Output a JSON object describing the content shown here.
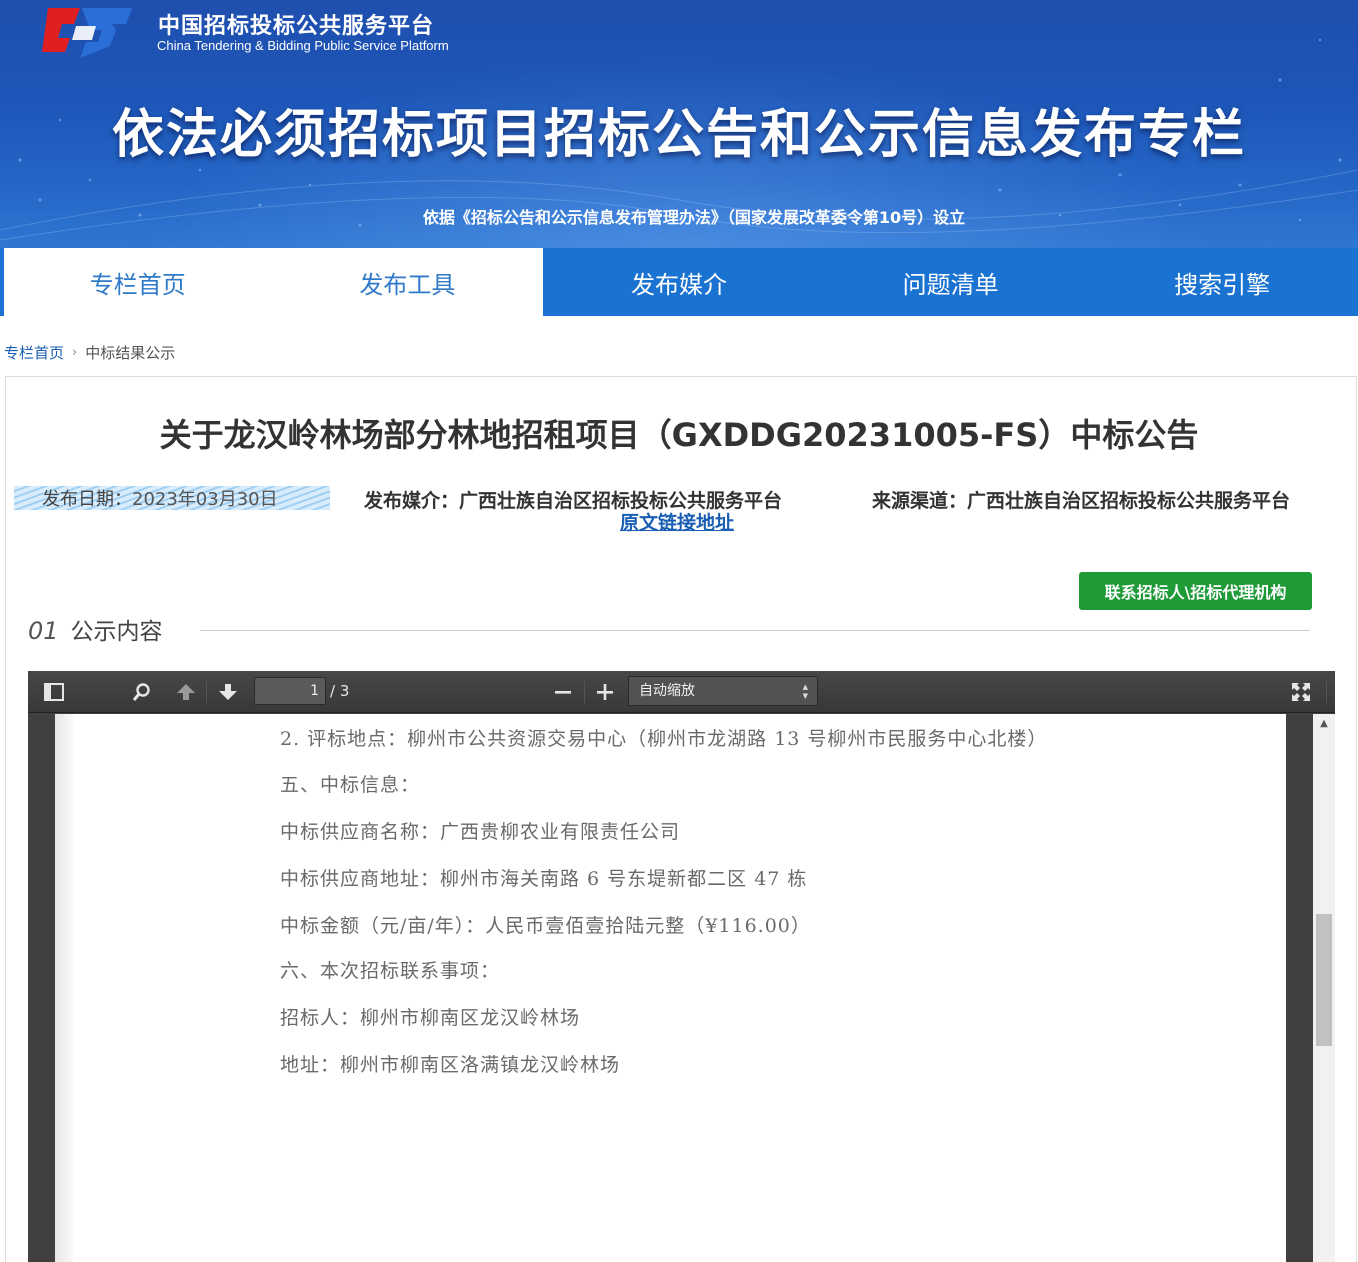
{
  "header": {
    "brand_cn": "中国招标投标公共服务平台",
    "brand_en": "China Tendering & Bidding Public Service Platform",
    "banner_title": "依法必须招标项目招标公告和公示信息发布专栏",
    "banner_subtitle": "依据《招标公告和公示信息发布管理办法》（国家发展改革委令第10号）设立"
  },
  "nav": {
    "items": [
      {
        "label": "专栏首页"
      },
      {
        "label": "发布工具"
      },
      {
        "label": "发布媒介"
      },
      {
        "label": "问题清单"
      },
      {
        "label": "搜索引擎"
      }
    ]
  },
  "breadcrumb": {
    "home": "专栏首页",
    "separator": "›",
    "current": "中标结果公示"
  },
  "notice": {
    "title": "关于龙汉岭林场部分林地招租项目（GXDDG20231005-FS）中标公告",
    "date_label": "发布日期：",
    "date_value": "2023年03月30日",
    "media": "发布媒介：广西壮族自治区招标投标公共服务平台",
    "source": "来源渠道：广西壮族自治区招标投标公共服务平台",
    "origin_link": "原文链接地址",
    "contact_button": "联系招标人\\招标代理机构",
    "section_number": "01",
    "section_label": "公示内容"
  },
  "viewer": {
    "page_current": "1",
    "page_total": "/ 3",
    "zoom": "自动缩放",
    "icons": [
      "sidebar-toggle-icon",
      "search-icon",
      "arrow-up-icon",
      "arrow-down-icon",
      "zoom-out-icon",
      "zoom-in-icon",
      "fullscreen-icon"
    ],
    "lines": [
      "2. 评标地点：柳州市公共资源交易中心（柳州市龙湖路 13 号柳州市民服务中心北楼）",
      "五、中标信息：",
      "中标供应商名称：广西贵柳农业有限责任公司",
      "中标供应商地址：柳州市海关南路 6 号东堤新都二区 47 栋",
      "中标金额（元/亩/年）：人民币壹佰壹拾陆元整（¥116.00）",
      "六、本次招标联系事项：",
      "招标人：柳州市柳南区龙汉岭林场",
      "地址：柳州市柳南区洛满镇龙汉岭林场"
    ]
  },
  "colors": {
    "nav_blue": "#1a73d1",
    "nav_light_text": "#2f7ac9",
    "contact_green": "#1e9a37",
    "link_blue": "#1a5fb4"
  }
}
